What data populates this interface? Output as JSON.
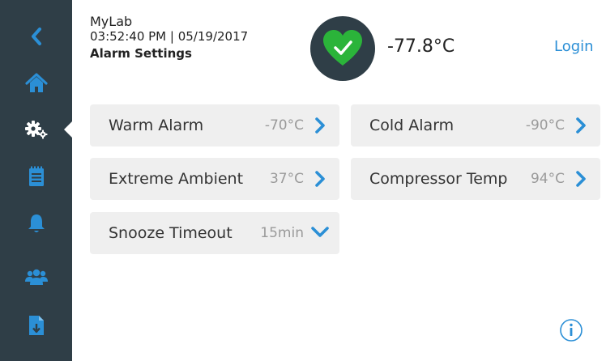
{
  "header": {
    "lab_name": "MyLab",
    "datetime": "03:52:40 PM | 05/19/2017",
    "page_title": "Alarm Settings",
    "temperature": "-77.8°C",
    "login_label": "Login",
    "status_icon": "heart-check-icon"
  },
  "sidebar": {
    "items": [
      {
        "name": "back",
        "icon": "chevron-left-icon"
      },
      {
        "name": "home",
        "icon": "home-icon"
      },
      {
        "name": "settings",
        "icon": "gears-icon",
        "active": true
      },
      {
        "name": "log",
        "icon": "notepad-icon"
      },
      {
        "name": "alarms",
        "icon": "bell-icon"
      },
      {
        "name": "users",
        "icon": "users-icon"
      },
      {
        "name": "export",
        "icon": "file-download-icon"
      }
    ]
  },
  "settings": [
    {
      "label": "Warm Alarm",
      "value": "-70°C",
      "action": "chevron-right-icon"
    },
    {
      "label": "Cold Alarm",
      "value": "-90°C",
      "action": "chevron-right-icon"
    },
    {
      "label": "Extreme Ambient",
      "value": "37°C",
      "action": "chevron-right-icon"
    },
    {
      "label": "Compressor Temp",
      "value": "94°C",
      "action": "chevron-right-icon"
    },
    {
      "label": "Snooze Timeout",
      "value": "15min",
      "action": "chevron-down-icon"
    }
  ],
  "colors": {
    "sidebar": "#2f3e47",
    "accent_blue": "#2b8fd6",
    "status_green": "#2bb43a",
    "card_bg": "#efefef",
    "value_gray": "#9a9a9a"
  }
}
